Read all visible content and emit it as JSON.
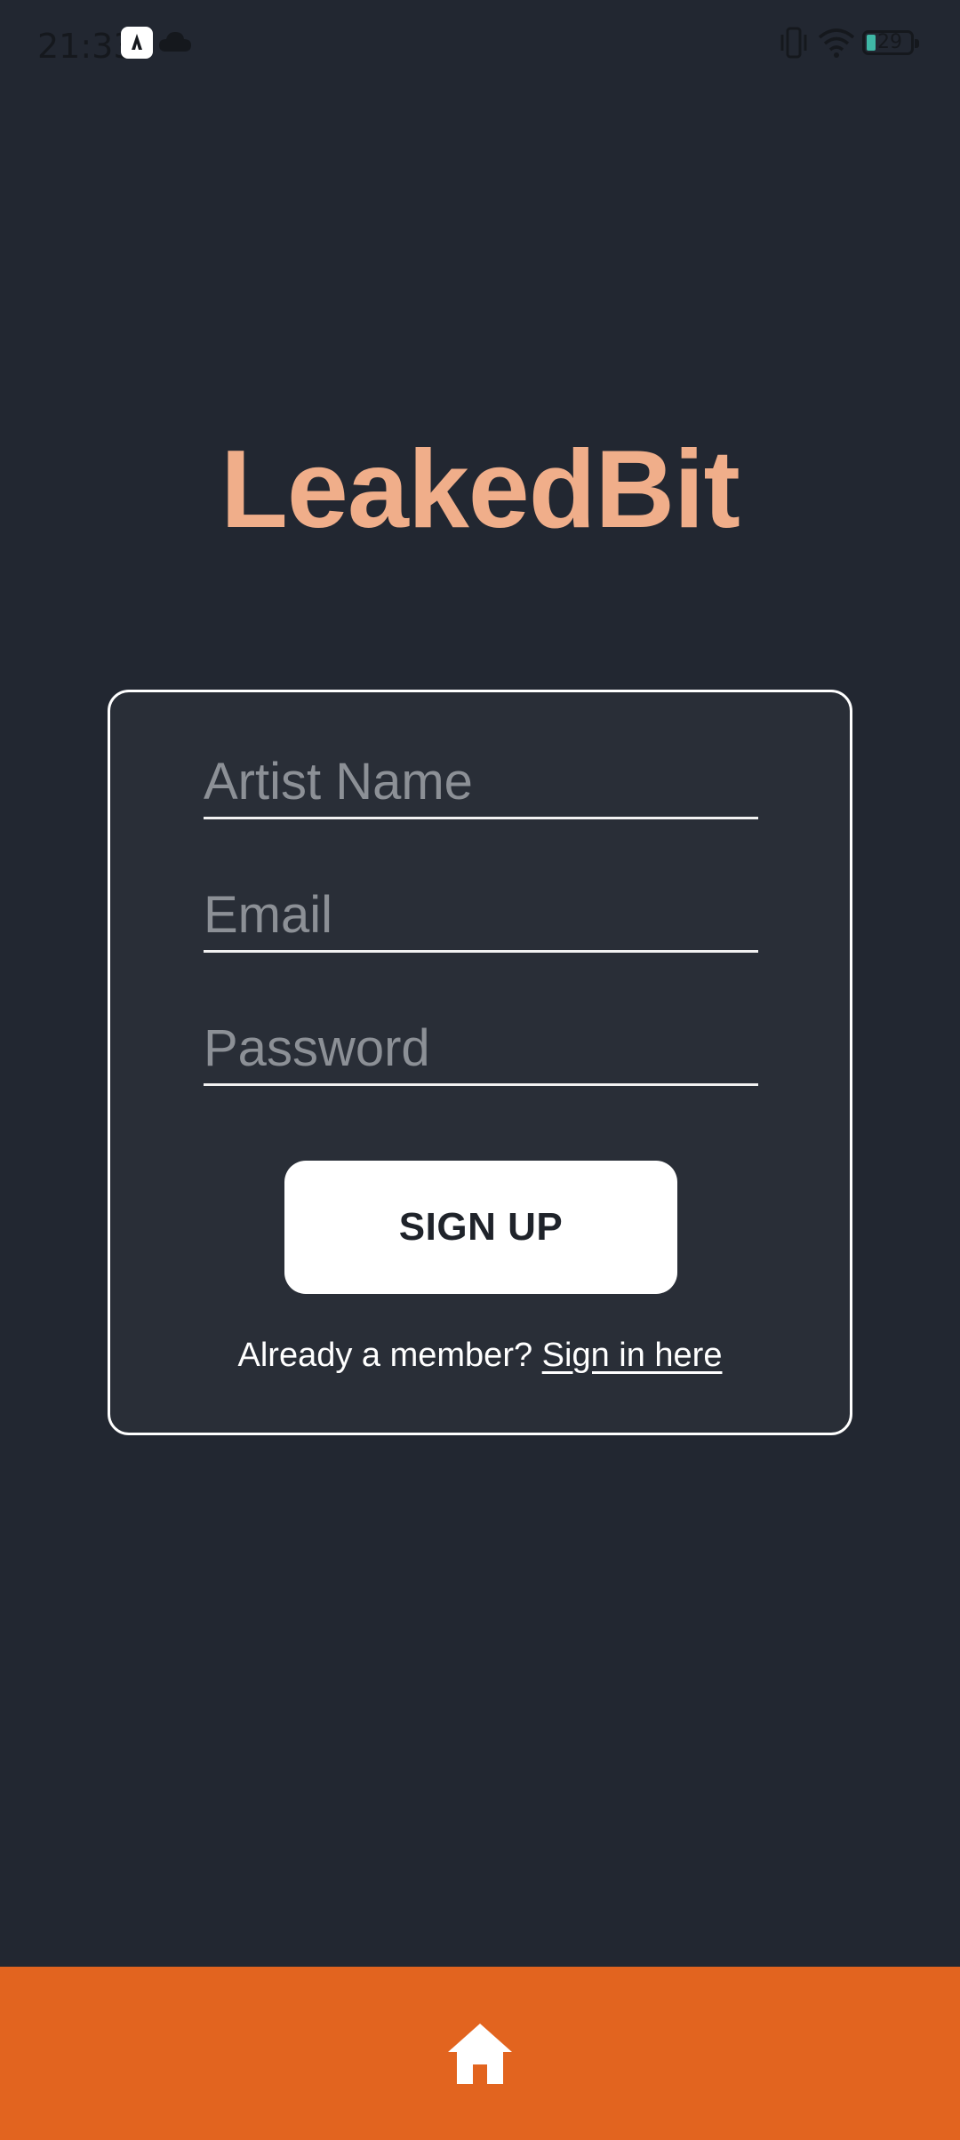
{
  "status_bar": {
    "time": "21:33",
    "battery_level": "29",
    "icons": [
      "app-notification-icon",
      "cloud-icon",
      "vibrate-icon",
      "wifi-icon",
      "battery-icon"
    ]
  },
  "app": {
    "title": "LeakedBit"
  },
  "form": {
    "artist_name_placeholder": "Artist Name",
    "artist_name_value": "",
    "email_placeholder": "Email",
    "email_value": "",
    "password_placeholder": "Password",
    "password_value": "",
    "signup_label": "SIGN UP",
    "member_prompt": "Already a member? ",
    "signin_link": "Sign in here"
  },
  "bottom_nav": {
    "icon": "home-icon"
  },
  "colors": {
    "background": "#222731",
    "card_background": "#292e37",
    "title": "#f0ae8a",
    "nav_bar": "#e2641f",
    "button": "#ffffff"
  }
}
